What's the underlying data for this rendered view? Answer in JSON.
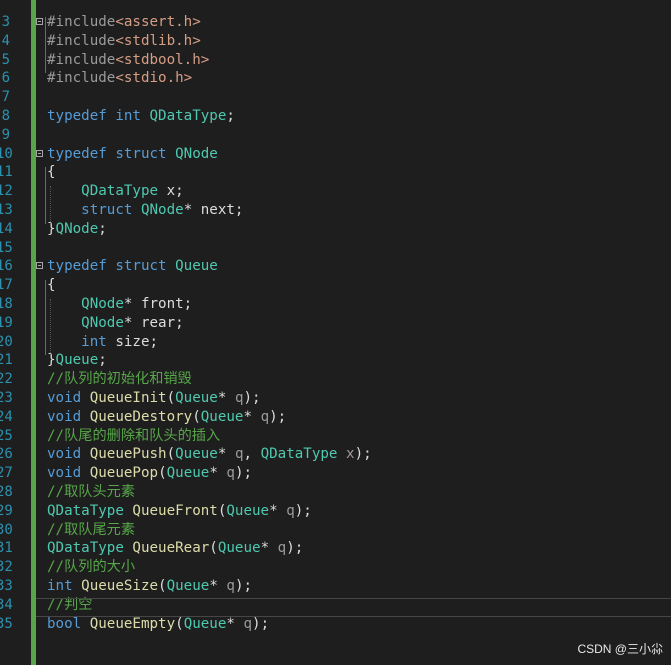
{
  "editor": {
    "lines": [
      {
        "num": "3",
        "segments": [
          {
            "t": "#include",
            "c": "pp"
          },
          {
            "t": "<assert.h>",
            "c": "str"
          }
        ]
      },
      {
        "num": "4",
        "segments": [
          {
            "t": "#include",
            "c": "pp"
          },
          {
            "t": "<stdlib.h>",
            "c": "str"
          }
        ]
      },
      {
        "num": "5",
        "segments": [
          {
            "t": "#include",
            "c": "pp"
          },
          {
            "t": "<stdbool.h>",
            "c": "str"
          }
        ]
      },
      {
        "num": "6",
        "segments": [
          {
            "t": "#include",
            "c": "pp"
          },
          {
            "t": "<stdio.h>",
            "c": "str"
          }
        ]
      },
      {
        "num": "7",
        "segments": []
      },
      {
        "num": "8",
        "segments": [
          {
            "t": "typedef",
            "c": "kw"
          },
          {
            "t": " "
          },
          {
            "t": "int",
            "c": "kw"
          },
          {
            "t": " "
          },
          {
            "t": "QDataType",
            "c": "ty"
          },
          {
            "t": ";"
          }
        ]
      },
      {
        "num": "9",
        "segments": []
      },
      {
        "num": "10",
        "segments": [
          {
            "t": "typedef",
            "c": "kw"
          },
          {
            "t": " "
          },
          {
            "t": "struct",
            "c": "kw"
          },
          {
            "t": " "
          },
          {
            "t": "QNode",
            "c": "ty"
          }
        ]
      },
      {
        "num": "11",
        "segments": [
          {
            "t": "{"
          }
        ]
      },
      {
        "num": "12",
        "segments": [
          {
            "t": "    "
          },
          {
            "t": "QDataType",
            "c": "ty"
          },
          {
            "t": " x;"
          }
        ]
      },
      {
        "num": "13",
        "segments": [
          {
            "t": "    "
          },
          {
            "t": "struct",
            "c": "kw"
          },
          {
            "t": " "
          },
          {
            "t": "QNode",
            "c": "ty"
          },
          {
            "t": "* next;"
          }
        ]
      },
      {
        "num": "14",
        "segments": [
          {
            "t": "}"
          },
          {
            "t": "QNode",
            "c": "ty"
          },
          {
            "t": ";"
          }
        ]
      },
      {
        "num": "15",
        "segments": []
      },
      {
        "num": "16",
        "segments": [
          {
            "t": "typedef",
            "c": "kw"
          },
          {
            "t": " "
          },
          {
            "t": "struct",
            "c": "kw"
          },
          {
            "t": " "
          },
          {
            "t": "Queue",
            "c": "ty"
          }
        ]
      },
      {
        "num": "17",
        "segments": [
          {
            "t": "{"
          }
        ]
      },
      {
        "num": "18",
        "segments": [
          {
            "t": "    "
          },
          {
            "t": "QNode",
            "c": "ty"
          },
          {
            "t": "* front;"
          }
        ]
      },
      {
        "num": "19",
        "segments": [
          {
            "t": "    "
          },
          {
            "t": "QNode",
            "c": "ty"
          },
          {
            "t": "* rear;"
          }
        ]
      },
      {
        "num": "20",
        "segments": [
          {
            "t": "    "
          },
          {
            "t": "int",
            "c": "kw"
          },
          {
            "t": " size;"
          }
        ]
      },
      {
        "num": "21",
        "segments": [
          {
            "t": "}"
          },
          {
            "t": "Queue",
            "c": "ty"
          },
          {
            "t": ";"
          }
        ]
      },
      {
        "num": "22",
        "segments": [
          {
            "t": "//队列的初始化和销毁",
            "c": "cm"
          }
        ]
      },
      {
        "num": "23",
        "segments": [
          {
            "t": "void",
            "c": "kw"
          },
          {
            "t": " "
          },
          {
            "t": "QueueInit",
            "c": "fn"
          },
          {
            "t": "("
          },
          {
            "t": "Queue",
            "c": "ty"
          },
          {
            "t": "* "
          },
          {
            "t": "q",
            "c": "pm"
          },
          {
            "t": ");"
          }
        ]
      },
      {
        "num": "24",
        "segments": [
          {
            "t": "void",
            "c": "kw"
          },
          {
            "t": " "
          },
          {
            "t": "QueueDestory",
            "c": "fn"
          },
          {
            "t": "("
          },
          {
            "t": "Queue",
            "c": "ty"
          },
          {
            "t": "* "
          },
          {
            "t": "q",
            "c": "pm"
          },
          {
            "t": ");"
          }
        ]
      },
      {
        "num": "25",
        "segments": [
          {
            "t": "//队尾的删除和队头的插入",
            "c": "cm"
          }
        ]
      },
      {
        "num": "26",
        "segments": [
          {
            "t": "void",
            "c": "kw"
          },
          {
            "t": " "
          },
          {
            "t": "QueuePush",
            "c": "fn"
          },
          {
            "t": "("
          },
          {
            "t": "Queue",
            "c": "ty"
          },
          {
            "t": "* "
          },
          {
            "t": "q",
            "c": "pm"
          },
          {
            "t": ", "
          },
          {
            "t": "QDataType",
            "c": "ty"
          },
          {
            "t": " "
          },
          {
            "t": "x",
            "c": "pm"
          },
          {
            "t": ");"
          }
        ]
      },
      {
        "num": "27",
        "segments": [
          {
            "t": "void",
            "c": "kw"
          },
          {
            "t": " "
          },
          {
            "t": "QueuePop",
            "c": "fn"
          },
          {
            "t": "("
          },
          {
            "t": "Queue",
            "c": "ty"
          },
          {
            "t": "* "
          },
          {
            "t": "q",
            "c": "pm"
          },
          {
            "t": ");"
          }
        ]
      },
      {
        "num": "28",
        "segments": [
          {
            "t": "//取队头元素",
            "c": "cm"
          }
        ]
      },
      {
        "num": "29",
        "segments": [
          {
            "t": "QDataType",
            "c": "ty"
          },
          {
            "t": " "
          },
          {
            "t": "QueueFront",
            "c": "fn"
          },
          {
            "t": "("
          },
          {
            "t": "Queue",
            "c": "ty"
          },
          {
            "t": "* "
          },
          {
            "t": "q",
            "c": "pm"
          },
          {
            "t": ");"
          }
        ]
      },
      {
        "num": "30",
        "segments": [
          {
            "t": "//取队尾元素",
            "c": "cm"
          }
        ]
      },
      {
        "num": "31",
        "segments": [
          {
            "t": "QDataType",
            "c": "ty"
          },
          {
            "t": " "
          },
          {
            "t": "QueueRear",
            "c": "fn"
          },
          {
            "t": "("
          },
          {
            "t": "Queue",
            "c": "ty"
          },
          {
            "t": "* "
          },
          {
            "t": "q",
            "c": "pm"
          },
          {
            "t": ");"
          }
        ]
      },
      {
        "num": "32",
        "segments": [
          {
            "t": "//队列的大小",
            "c": "cm"
          }
        ]
      },
      {
        "num": "33",
        "segments": [
          {
            "t": "int",
            "c": "kw"
          },
          {
            "t": " "
          },
          {
            "t": "QueueSize",
            "c": "fn"
          },
          {
            "t": "("
          },
          {
            "t": "Queue",
            "c": "ty"
          },
          {
            "t": "* "
          },
          {
            "t": "q",
            "c": "pm"
          },
          {
            "t": ");"
          }
        ]
      },
      {
        "num": "34",
        "segments": [
          {
            "t": "//判空",
            "c": "cm"
          }
        ]
      },
      {
        "num": "35",
        "segments": [
          {
            "t": "bool",
            "c": "kw"
          },
          {
            "t": " "
          },
          {
            "t": "QueueEmpty",
            "c": "fn"
          },
          {
            "t": "("
          },
          {
            "t": "Queue",
            "c": "ty"
          },
          {
            "t": "* "
          },
          {
            "t": "q",
            "c": "pm"
          },
          {
            "t": ");"
          }
        ]
      }
    ]
  },
  "watermark": "CSDN @三小尛",
  "colors": {
    "background": "#1e1e1e",
    "line_number": "#2b91af",
    "keyword": "#569cd6",
    "type": "#4ec9b0",
    "function": "#dcdcaa",
    "string": "#d69d85",
    "comment": "#57a64a",
    "change_bar": "#57a64a"
  }
}
